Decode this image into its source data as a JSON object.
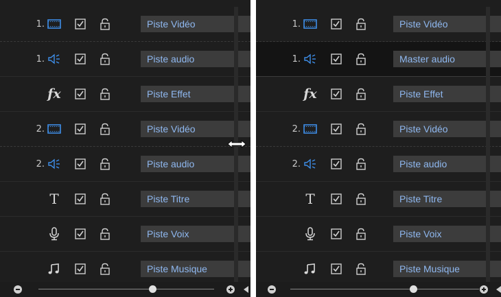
{
  "left_panel": {
    "tracks": [
      {
        "index": "1.",
        "type": "video",
        "icon": "film-icon",
        "checked": true,
        "label": "Piste Vidéo"
      },
      {
        "index": "1.",
        "type": "audio",
        "icon": "speaker-icon",
        "checked": true,
        "label": "Piste audio"
      },
      {
        "index": "",
        "type": "effect",
        "icon": "fx-icon",
        "icon_text": "fx",
        "checked": true,
        "label": "Piste Effet"
      },
      {
        "index": "2.",
        "type": "video",
        "icon": "film-icon",
        "checked": true,
        "label": "Piste Vidéo"
      },
      {
        "index": "2.",
        "type": "audio",
        "icon": "speaker-icon",
        "checked": true,
        "label": "Piste audio"
      },
      {
        "index": "",
        "type": "title",
        "icon": "title-icon",
        "icon_text": "T",
        "checked": true,
        "label": "Piste Titre"
      },
      {
        "index": "",
        "type": "voice",
        "icon": "microphone-icon",
        "checked": true,
        "label": "Piste Voix"
      },
      {
        "index": "",
        "type": "music",
        "icon": "music-note-icon",
        "checked": true,
        "label": "Piste Musique"
      }
    ]
  },
  "right_panel": {
    "tracks": [
      {
        "index": "1.",
        "type": "video",
        "icon": "film-icon",
        "checked": true,
        "label": "Piste Vidéo"
      },
      {
        "index": "1.",
        "type": "audio",
        "icon": "speaker-icon",
        "checked": true,
        "label": "Master audio"
      },
      {
        "index": "",
        "type": "effect",
        "icon": "fx-icon",
        "icon_text": "fx",
        "checked": true,
        "label": "Piste Effet"
      },
      {
        "index": "2.",
        "type": "video",
        "icon": "film-icon",
        "checked": true,
        "label": "Piste Vidéo"
      },
      {
        "index": "2.",
        "type": "audio",
        "icon": "speaker-icon",
        "checked": true,
        "label": "Piste audio"
      },
      {
        "index": "",
        "type": "title",
        "icon": "title-icon",
        "icon_text": "T",
        "checked": true,
        "label": "Piste Titre"
      },
      {
        "index": "",
        "type": "voice",
        "icon": "microphone-icon",
        "checked": true,
        "label": "Piste Voix"
      },
      {
        "index": "",
        "type": "music",
        "icon": "music-note-icon",
        "checked": true,
        "label": "Piste Musique"
      }
    ]
  },
  "zoom": {
    "level_fraction": 0.65
  },
  "colors": {
    "background": "#1e1e1e",
    "label_bg": "#3c3c3c",
    "label_text": "#8fb8f0",
    "icon_blue": "#3e8ee8",
    "icon_gray": "#d8d8d8"
  }
}
